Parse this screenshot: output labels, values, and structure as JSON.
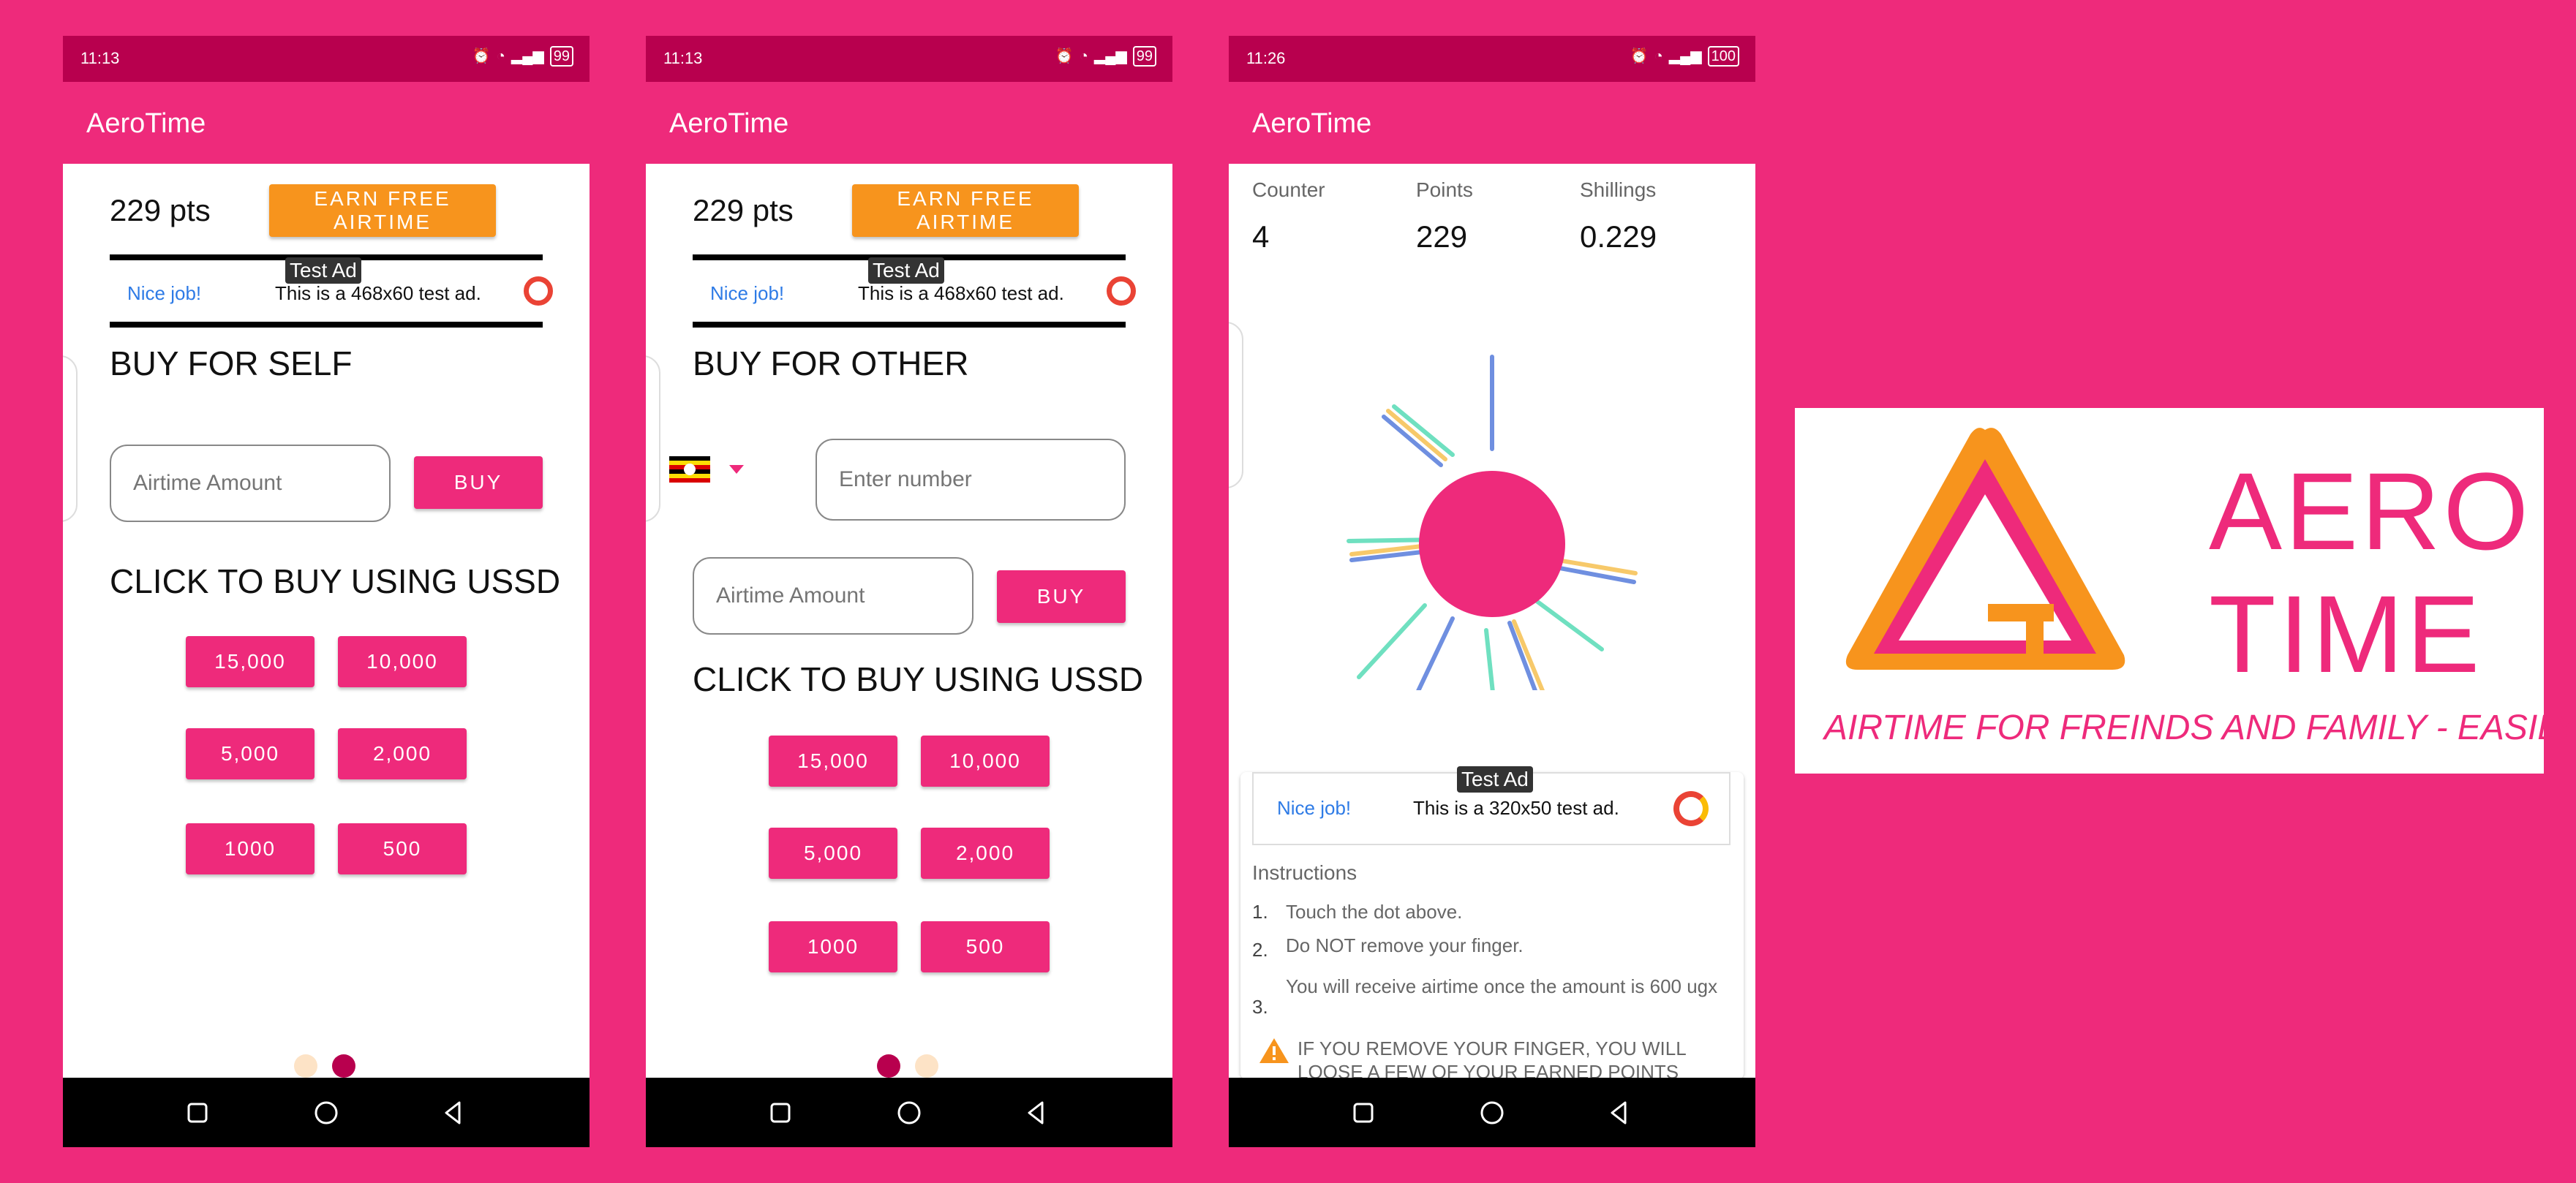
{
  "colors": {
    "pink": "#EE2A7B",
    "status_bar": "#B8004E",
    "orange": "#F7941D",
    "white": "#FFFFFF",
    "black": "#000000"
  },
  "app_title": "AeroTime",
  "phone1": {
    "status": {
      "time": "11:13",
      "battery": "99"
    },
    "points": "229 pts",
    "earn_button": "EARN FREE AIRTIME",
    "ad": {
      "label": "Test Ad",
      "nice": "Nice job!",
      "text": "This is a 468x60 test ad."
    },
    "heading": "BUY FOR SELF",
    "amount_placeholder": "Airtime Amount",
    "buy_button": "BUY",
    "ussd_heading": "CLICK TO BUY USING USSD",
    "ussd_buttons": [
      "15,000",
      "10,000",
      "5,000",
      "2,000",
      "1000",
      "500"
    ]
  },
  "phone2": {
    "status": {
      "time": "11:13",
      "battery": "99"
    },
    "points": "229 pts",
    "earn_button": "EARN FREE AIRTIME",
    "ad": {
      "label": "Test Ad",
      "nice": "Nice job!",
      "text": "This is a 468x60 test ad."
    },
    "heading": "BUY FOR OTHER",
    "number_placeholder": "Enter number",
    "amount_placeholder": "Airtime Amount",
    "buy_button": "BUY",
    "ussd_heading": "CLICK TO BUY USING USSD",
    "ussd_buttons": [
      "15,000",
      "10,000",
      "5,000",
      "2,000",
      "1000",
      "500"
    ]
  },
  "phone3": {
    "status": {
      "time": "11:26",
      "battery": "100"
    },
    "stats": {
      "counter_label": "Counter",
      "counter_value": "4",
      "points_label": "Points",
      "points_value": "229",
      "shillings_label": "Shillings",
      "shillings_value": "0.229"
    },
    "ad": {
      "label": "Test Ad",
      "nice": "Nice job!",
      "text": "This is a 320x50 test ad."
    },
    "instructions_title": "Instructions",
    "instructions": [
      {
        "num": "1.",
        "text": "Touch the dot above."
      },
      {
        "num": "2.",
        "text": "Do NOT remove your finger."
      },
      {
        "num": "3.",
        "text": "You will receive airtime once the amount is 600 ugx"
      }
    ],
    "warning": "IF YOU REMOVE YOUR FINGER, YOU WILL LOOSE A FEW OF YOUR EARNED POINTS"
  },
  "banner": {
    "word1": "AERO",
    "word2": "TIME",
    "tagline": "AIRTIME FOR FREINDS AND FAMILY - EASILY"
  }
}
